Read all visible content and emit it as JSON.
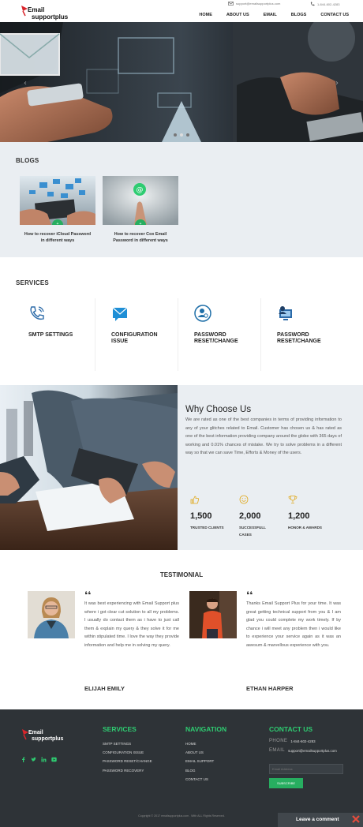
{
  "header": {
    "logo_line1": "Email",
    "logo_line2": "supportplus",
    "email": "support@emailsupportplus.com",
    "phone": "1-844-602-4283",
    "nav": [
      "HOME",
      "ABOUT US",
      "EMAIL",
      "BLOGS",
      "CONTACT US"
    ]
  },
  "blogs": {
    "title": "BLOGS",
    "items": [
      {
        "line1": "How to recover iCloud Password",
        "line2": "in different ways"
      },
      {
        "line1": "How to recover Cox Email",
        "line2": "Password in different ways"
      }
    ]
  },
  "services": {
    "title": "SERVICES",
    "items": [
      {
        "line1": "SMTP SETTINGS",
        "line2": ""
      },
      {
        "line1": "CONFIGURATION",
        "line2": "ISSUE"
      },
      {
        "line1": "PASSWORD",
        "line2": "RESET/CHANGE"
      },
      {
        "line1": "PASSWORD",
        "line2": "RESET/CHANGE"
      }
    ]
  },
  "why": {
    "title": "Why Choose Us",
    "text": "We are rated as one of the best companies in terms of providing information to any of your glitches related to Email. Customer has chosen us & has rated as one of the best information providing company around the globe with 365 days of working and 0.01% chances of mistake. We try to solve problems in a different way so that we can save Time, Efforts & Money of the users.",
    "stats": [
      {
        "num": "1,500",
        "line1": "TRUSTED CLIENTS",
        "line2": ""
      },
      {
        "num": "2,000",
        "line1": "SUCCESSFULL",
        "line2": "CASES"
      },
      {
        "num": "1,200",
        "line1": "HONOR & AWARDS",
        "line2": ""
      }
    ]
  },
  "testimonial": {
    "title": "TESTIMONIAL",
    "items": [
      {
        "text": "It was best experiencing with Email Support plus where i got clear cut solution to all my problems. I usually do contact them as i have to just call them & explain my query & they solve it for me within stipulated time. I love the way they provide information and help me in solving my query.",
        "name": "ELIJAH EMILY"
      },
      {
        "text": "Thanks Email Support Plus for your time. It was great getting technical support from you & I am glad you could complete my work timely. If by chance i will meet any problem then i would like to experience your service again as it was an awesum & marvellous experience with you.",
        "name": "ETHAN HARPER"
      }
    ]
  },
  "footer": {
    "logo_line1": "Email",
    "logo_line2": "supportplus",
    "services_title": "SERVICES",
    "services": [
      "SMTP SETTINGS",
      "CONFIGURATION ISSUE",
      "PASSWORD RESET/CHANGE",
      "PASSWORD RECOVERY"
    ],
    "nav_title": "NAVIGATION",
    "nav": [
      "HOME",
      "ABOUT US",
      "EMAIL SUPPORT",
      "BLOG",
      "CONTACT US"
    ],
    "contact_title": "CONTACT US",
    "phone_label": "PHONE",
    "phone": "1-844-602-4283",
    "email_label": "EMAIL",
    "email": "support@emailsupportplus.com",
    "email_placeholder": "Email Address",
    "subscribe": "SUBSCRIBE",
    "copyright": "Copyright © 2017 emailsupportplus.com . With ALL Rights Reserved.",
    "leave_comment": "Leave a comment"
  },
  "colors": {
    "accent": "#2ecc71",
    "footer_bg": "#2e3337",
    "section_bg": "#eaeef2",
    "logo_red": "#d9262c"
  }
}
